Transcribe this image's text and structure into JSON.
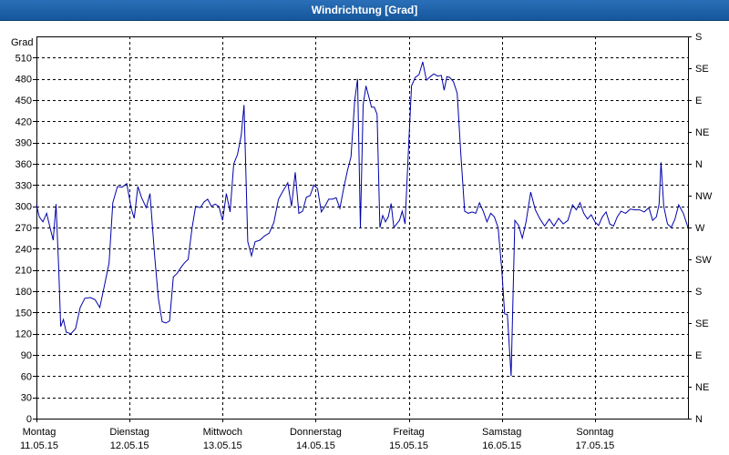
{
  "window": {
    "title": "Windrichtung [Grad]"
  },
  "chart_data": {
    "type": "line",
    "title": "Windrichtung [Grad]",
    "ylabel": "Grad",
    "ylim": [
      0,
      540
    ],
    "yticks": [
      0,
      30,
      60,
      90,
      120,
      150,
      180,
      210,
      240,
      270,
      300,
      330,
      360,
      390,
      420,
      450,
      480,
      510
    ],
    "right_ticks": [
      {
        "value": 0,
        "label": "N"
      },
      {
        "value": 45,
        "label": "NE"
      },
      {
        "value": 90,
        "label": "E"
      },
      {
        "value": 135,
        "label": "SE"
      },
      {
        "value": 180,
        "label": "S"
      },
      {
        "value": 225,
        "label": "SW"
      },
      {
        "value": 270,
        "label": "W"
      },
      {
        "value": 315,
        "label": "NW"
      },
      {
        "value": 360,
        "label": "N"
      },
      {
        "value": 405,
        "label": "NE"
      },
      {
        "value": 450,
        "label": "E"
      },
      {
        "value": 495,
        "label": "SE"
      },
      {
        "value": 540,
        "label": "S"
      }
    ],
    "xlim": [
      0,
      7
    ],
    "x_categories": [
      {
        "day": "Montag",
        "date": "11.05.15"
      },
      {
        "day": "Dienstag",
        "date": "12.05.15"
      },
      {
        "day": "Mittwoch",
        "date": "13.05.15"
      },
      {
        "day": "Donnerstag",
        "date": "14.05.15"
      },
      {
        "day": "Freitag",
        "date": "15.05.15"
      },
      {
        "day": "Samstag",
        "date": "16.05.15"
      },
      {
        "day": "Sonntag",
        "date": "17.05.15"
      }
    ],
    "grid": true,
    "series": [
      {
        "color": "#0000aa",
        "points": [
          [
            0.0,
            302
          ],
          [
            0.03,
            285
          ],
          [
            0.07,
            278
          ],
          [
            0.11,
            290
          ],
          [
            0.15,
            268
          ],
          [
            0.18,
            252
          ],
          [
            0.21,
            303
          ],
          [
            0.24,
            210
          ],
          [
            0.26,
            130
          ],
          [
            0.29,
            140
          ],
          [
            0.32,
            122
          ],
          [
            0.37,
            120
          ],
          [
            0.42,
            127
          ],
          [
            0.47,
            157
          ],
          [
            0.52,
            170
          ],
          [
            0.58,
            171
          ],
          [
            0.63,
            168
          ],
          [
            0.68,
            157
          ],
          [
            0.73,
            188
          ],
          [
            0.78,
            220
          ],
          [
            0.82,
            305
          ],
          [
            0.87,
            328
          ],
          [
            0.92,
            327
          ],
          [
            0.97,
            332
          ],
          [
            1.02,
            296
          ],
          [
            1.05,
            283
          ],
          [
            1.09,
            328
          ],
          [
            1.13,
            312
          ],
          [
            1.18,
            298
          ],
          [
            1.22,
            318
          ],
          [
            1.27,
            230
          ],
          [
            1.31,
            170
          ],
          [
            1.35,
            137
          ],
          [
            1.39,
            135
          ],
          [
            1.43,
            138
          ],
          [
            1.47,
            200
          ],
          [
            1.51,
            205
          ],
          [
            1.55,
            213
          ],
          [
            1.59,
            220
          ],
          [
            1.63,
            225
          ],
          [
            1.67,
            268
          ],
          [
            1.71,
            300
          ],
          [
            1.76,
            298
          ],
          [
            1.8,
            306
          ],
          [
            1.84,
            310
          ],
          [
            1.88,
            300
          ],
          [
            1.92,
            303
          ],
          [
            1.96,
            300
          ],
          [
            2.0,
            280
          ],
          [
            2.04,
            318
          ],
          [
            2.08,
            292
          ],
          [
            2.12,
            360
          ],
          [
            2.16,
            373
          ],
          [
            2.2,
            400
          ],
          [
            2.23,
            443
          ],
          [
            2.27,
            250
          ],
          [
            2.31,
            230
          ],
          [
            2.35,
            250
          ],
          [
            2.4,
            252
          ],
          [
            2.45,
            258
          ],
          [
            2.5,
            262
          ],
          [
            2.55,
            277
          ],
          [
            2.6,
            310
          ],
          [
            2.65,
            322
          ],
          [
            2.7,
            333
          ],
          [
            2.74,
            300
          ],
          [
            2.78,
            348
          ],
          [
            2.82,
            290
          ],
          [
            2.86,
            293
          ],
          [
            2.9,
            313
          ],
          [
            2.94,
            315
          ],
          [
            2.98,
            330
          ],
          [
            3.02,
            325
          ],
          [
            3.06,
            292
          ],
          [
            3.1,
            300
          ],
          [
            3.14,
            310
          ],
          [
            3.18,
            310
          ],
          [
            3.22,
            312
          ],
          [
            3.26,
            297
          ],
          [
            3.3,
            325
          ],
          [
            3.34,
            350
          ],
          [
            3.38,
            370
          ],
          [
            3.42,
            450
          ],
          [
            3.45,
            480
          ],
          [
            3.48,
            270
          ],
          [
            3.51,
            443
          ],
          [
            3.54,
            470
          ],
          [
            3.57,
            455
          ],
          [
            3.6,
            440
          ],
          [
            3.63,
            440
          ],
          [
            3.66,
            430
          ],
          [
            3.69,
            270
          ],
          [
            3.72,
            287
          ],
          [
            3.75,
            278
          ],
          [
            3.78,
            285
          ],
          [
            3.81,
            304
          ],
          [
            3.84,
            270
          ],
          [
            3.87,
            275
          ],
          [
            3.9,
            280
          ],
          [
            3.93,
            293
          ],
          [
            3.96,
            275
          ],
          [
            4.0,
            390
          ],
          [
            4.03,
            470
          ],
          [
            4.07,
            482
          ],
          [
            4.11,
            486
          ],
          [
            4.15,
            504
          ],
          [
            4.19,
            478
          ],
          [
            4.23,
            483
          ],
          [
            4.27,
            487
          ],
          [
            4.31,
            484
          ],
          [
            4.35,
            485
          ],
          [
            4.38,
            464
          ],
          [
            4.41,
            483
          ],
          [
            4.44,
            482
          ],
          [
            4.48,
            476
          ],
          [
            4.52,
            460
          ],
          [
            4.56,
            372
          ],
          [
            4.6,
            293
          ],
          [
            4.64,
            290
          ],
          [
            4.68,
            292
          ],
          [
            4.72,
            290
          ],
          [
            4.76,
            305
          ],
          [
            4.8,
            293
          ],
          [
            4.84,
            278
          ],
          [
            4.88,
            290
          ],
          [
            4.92,
            285
          ],
          [
            4.96,
            270
          ],
          [
            5.0,
            210
          ],
          [
            5.03,
            148
          ],
          [
            5.06,
            147
          ],
          [
            5.1,
            60
          ],
          [
            5.14,
            280
          ],
          [
            5.18,
            273
          ],
          [
            5.22,
            255
          ],
          [
            5.26,
            278
          ],
          [
            5.31,
            320
          ],
          [
            5.36,
            295
          ],
          [
            5.41,
            282
          ],
          [
            5.46,
            272
          ],
          [
            5.51,
            282
          ],
          [
            5.56,
            272
          ],
          [
            5.61,
            283
          ],
          [
            5.66,
            275
          ],
          [
            5.71,
            280
          ],
          [
            5.76,
            302
          ],
          [
            5.8,
            295
          ],
          [
            5.84,
            305
          ],
          [
            5.88,
            290
          ],
          [
            5.92,
            282
          ],
          [
            5.96,
            288
          ],
          [
            6.0,
            278
          ],
          [
            6.04,
            273
          ],
          [
            6.08,
            285
          ],
          [
            6.12,
            292
          ],
          [
            6.16,
            275
          ],
          [
            6.2,
            272
          ],
          [
            6.24,
            285
          ],
          [
            6.28,
            293
          ],
          [
            6.33,
            290
          ],
          [
            6.38,
            296
          ],
          [
            6.43,
            295
          ],
          [
            6.48,
            295
          ],
          [
            6.53,
            292
          ],
          [
            6.58,
            298
          ],
          [
            6.62,
            280
          ],
          [
            6.66,
            285
          ],
          [
            6.69,
            303
          ],
          [
            6.71,
            362
          ],
          [
            6.74,
            300
          ],
          [
            6.78,
            275
          ],
          [
            6.82,
            270
          ],
          [
            6.86,
            282
          ],
          [
            6.9,
            302
          ],
          [
            6.95,
            290
          ],
          [
            7.0,
            270
          ]
        ]
      }
    ]
  }
}
